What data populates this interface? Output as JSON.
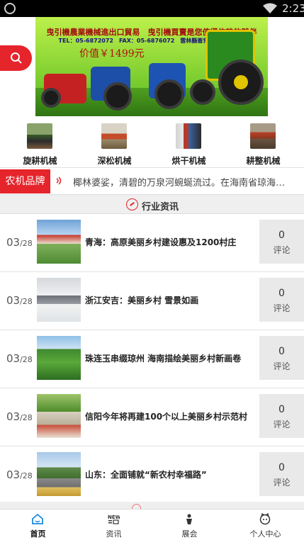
{
  "status_bar": {
    "time": "2:23"
  },
  "banner": {
    "line1": "曳引機農業機械進出口貿易　曳引機買賣是您值得信賴的夥伴",
    "line2": "TEL：05-6872072　FAX：05-6876072　雲林縣崙背鄉中正路26號",
    "price": "价值￥1499元"
  },
  "categories": [
    {
      "label": "旋耕机械",
      "icon": "rotary-tiller-photo"
    },
    {
      "label": "深松机械",
      "icon": "subsoiler-photo"
    },
    {
      "label": "烘干机械",
      "icon": "dryer-photo"
    },
    {
      "label": "耕整机械",
      "icon": "tillage-machine-photo"
    }
  ],
  "brand_bar": {
    "tag": "农机品牌",
    "ticker": "椰林婆娑，清碧的万泉河蜿蜒流过。在海南省琼海市..."
  },
  "section": {
    "title": "行业资讯"
  },
  "news": [
    {
      "month": "03",
      "day": "/28",
      "title": "青海：高原美丽乡村建设惠及1200村庄",
      "comments": "0",
      "comment_label": "评论"
    },
    {
      "month": "03",
      "day": "/28",
      "title": "浙江安吉：美丽乡村 雪景如画",
      "comments": "0",
      "comment_label": "评论"
    },
    {
      "month": "03",
      "day": "/28",
      "title": "珠连玉串缀琼州 海南描绘美丽乡村新画卷",
      "comments": "0",
      "comment_label": "评论"
    },
    {
      "month": "03",
      "day": "/28",
      "title": "信阳今年将再建100个以上美丽乡村示范村",
      "comments": "0",
      "comment_label": "评论"
    },
    {
      "month": "03",
      "day": "/28",
      "title": "山东：全面铺就“新农村幸福路”",
      "comments": "0",
      "comment_label": "评论"
    }
  ],
  "tabs": [
    {
      "label": "首页",
      "icon": "home-icon",
      "active": true
    },
    {
      "label": "资讯",
      "icon": "news-icon",
      "active": false
    },
    {
      "label": "展会",
      "icon": "exhibition-icon",
      "active": false
    },
    {
      "label": "个人中心",
      "icon": "profile-icon",
      "active": false
    }
  ],
  "colors": {
    "accent": "#e6242b",
    "tab_active": "#1a8be0"
  }
}
